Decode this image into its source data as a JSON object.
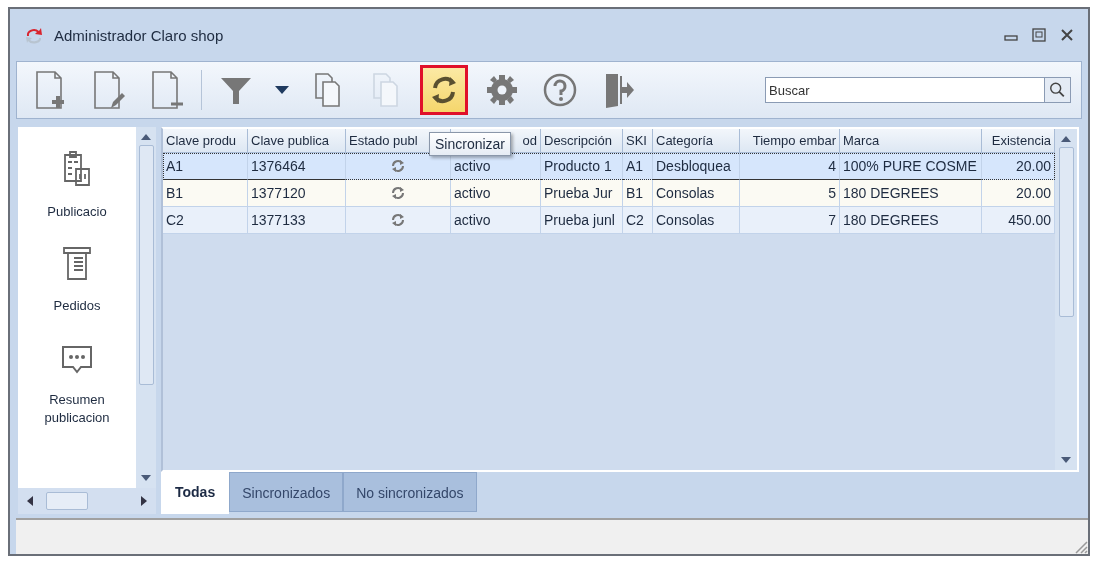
{
  "window": {
    "title": "Administrador Claro shop"
  },
  "toolbar": {
    "groups": [
      [
        {
          "kind": "new-doc",
          "disabled": false,
          "highlighted": false
        },
        {
          "kind": "edit-doc",
          "disabled": false,
          "highlighted": false
        },
        {
          "kind": "remove-doc",
          "disabled": false,
          "highlighted": false
        }
      ],
      [
        {
          "kind": "filter",
          "disabled": false,
          "highlighted": false
        },
        {
          "kind": "caret",
          "disabled": false,
          "highlighted": false
        },
        {
          "kind": "copy",
          "disabled": false,
          "highlighted": false
        },
        {
          "kind": "paste",
          "disabled": true,
          "highlighted": false
        },
        {
          "kind": "sync",
          "disabled": false,
          "highlighted": true
        },
        {
          "kind": "settings",
          "disabled": false,
          "highlighted": false
        },
        {
          "kind": "help",
          "disabled": false,
          "highlighted": false
        },
        {
          "kind": "exit",
          "disabled": false,
          "highlighted": false
        }
      ]
    ]
  },
  "tooltip": "Sincronizar",
  "search": {
    "placeholder": "Buscar"
  },
  "sidebar": {
    "items": [
      {
        "kind": "publications",
        "lines": [
          "Publicacio"
        ]
      },
      {
        "kind": "orders",
        "lines": [
          "Pedidos"
        ]
      },
      {
        "kind": "summary",
        "lines": [
          "Resumen",
          "publicacion"
        ]
      }
    ]
  },
  "table": {
    "columns": [
      {
        "label": "Clave produ",
        "kind": "text"
      },
      {
        "label": "Clave publica",
        "kind": "text"
      },
      {
        "label": "Estado publ",
        "kind": "icon"
      },
      {
        "label": "od",
        "kind": "text"
      },
      {
        "label": "Descripción",
        "kind": "text"
      },
      {
        "label": "SKI",
        "kind": "text"
      },
      {
        "label": "Categoría",
        "kind": "text"
      },
      {
        "label": "Tiempo embar",
        "kind": "number"
      },
      {
        "label": "Marca",
        "kind": "text"
      },
      {
        "label": "Existencia",
        "kind": "number"
      }
    ],
    "rows": [
      {
        "selected": true,
        "cells": [
          "A1",
          "1376464",
          "",
          "activo",
          "Producto 1",
          "A1",
          "Desbloquea",
          "4",
          "100% PURE COSME",
          "20.00"
        ]
      },
      {
        "selected": false,
        "cells": [
          "B1",
          "1377120",
          "",
          "activo",
          "Prueba Jur",
          "B1",
          "Consolas",
          "5",
          "180 DEGREES",
          "20.00"
        ]
      },
      {
        "selected": false,
        "cells": [
          "C2",
          "1377133",
          "",
          "activo",
          "Prueba junl",
          "C2",
          "Consolas",
          "7",
          "180 DEGREES",
          "450.00"
        ]
      }
    ]
  },
  "tabs": [
    {
      "label": "Todas",
      "selected": true
    },
    {
      "label": "Sincronizados",
      "selected": false
    },
    {
      "label": "No sincronizados",
      "selected": false
    }
  ]
}
